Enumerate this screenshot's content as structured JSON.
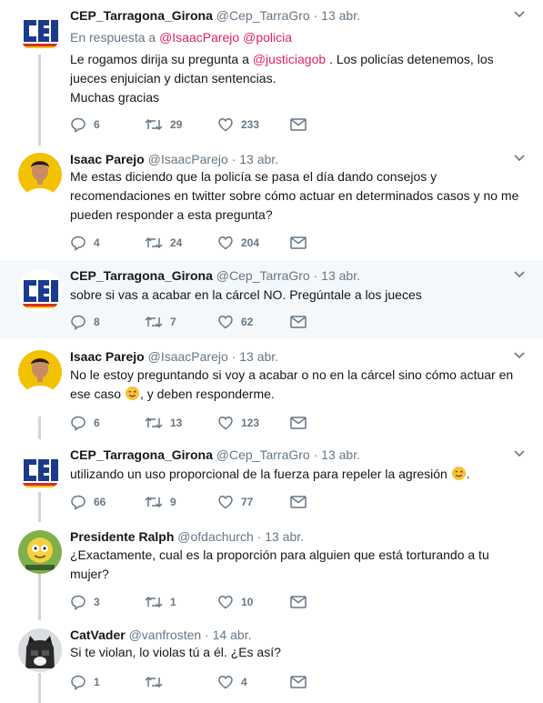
{
  "tweets": [
    {
      "name": "CEP_Tarragona_Girona",
      "handle": "@Cep_TarraGro",
      "sep": "·",
      "date": "13 abr.",
      "reply_prefix": "En respuesta a",
      "reply_users": [
        "@IsaacParejo",
        "@policia"
      ],
      "text_a": "Le rogamos dirija su pregunta a",
      "mention": "@justiciagob",
      "text_b": ". Los policías detenemos, los",
      "text_c": "jueces enjuician y dictan sentencias.",
      "text_d": "Muchas gracias",
      "replies": "6",
      "retweets": "29",
      "likes": "233",
      "avatar": "cep-logo"
    },
    {
      "name": "Isaac Parejo",
      "handle": "@IsaacParejo",
      "sep": "·",
      "date": "13 abr.",
      "lines": [
        "Me estas diciendo que la policía se pasa el día dando consejos y",
        "recomendaciones en twitter sobre cómo actuar en determinados casos y no me",
        "pueden responder a esta pregunta?"
      ],
      "replies": "4",
      "retweets": "24",
      "likes": "204",
      "avatar": "person-photo"
    },
    {
      "name": "CEP_Tarragona_Girona",
      "handle": "@Cep_TarraGro",
      "sep": "·",
      "date": "13 abr.",
      "lines": [
        "sobre si vas a acabar en la cárcel NO. Pregúntale a los jueces"
      ],
      "replies": "8",
      "retweets": "7",
      "likes": "62",
      "avatar": "cep-logo"
    },
    {
      "name": "Isaac Parejo",
      "handle": "@IsaacParejo",
      "sep": "·",
      "date": "13 abr.",
      "line1": "No le estoy preguntando si voy a acabar o no en la cárcel sino cómo actuar en",
      "line2a": "ese caso",
      "line2b": ", y deben responderme.",
      "emoji": "winking-face",
      "replies": "6",
      "retweets": "13",
      "likes": "123",
      "avatar": "person-photo"
    },
    {
      "name": "CEP_Tarragona_Girona",
      "handle": "@Cep_TarraGro",
      "sep": "·",
      "date": "13 abr.",
      "line1a": "utilizando un uso proporcional de la fuerza para repeler la agresión",
      "line1b": ".",
      "emoji": "winking-face",
      "replies": "66",
      "retweets": "9",
      "likes": "77",
      "avatar": "cep-logo"
    },
    {
      "name": "Presidente Ralph",
      "handle": "@ofdachurch",
      "sep": "·",
      "date": "13 abr.",
      "lines": [
        "¿Exactamente, cual es la proporción para alguien que está torturando a tu",
        "mujer?"
      ],
      "replies": "3",
      "retweets": "1",
      "likes": "10",
      "avatar": "cartoon-avatar"
    },
    {
      "name": "CatVader",
      "handle": "@vanfrosten",
      "sep": "·",
      "date": "14 abr.",
      "lines": [
        "Si te violan, lo violas tú a él. ¿Es así?"
      ],
      "replies": "1",
      "retweets": "",
      "likes": "4",
      "avatar": "cat-vader-avatar"
    }
  ],
  "colors": {
    "reply_link": "#e0245e",
    "muted": "#657786",
    "thread_line": "#ccd6dd",
    "highlight_bg": "#f5f8fa"
  }
}
